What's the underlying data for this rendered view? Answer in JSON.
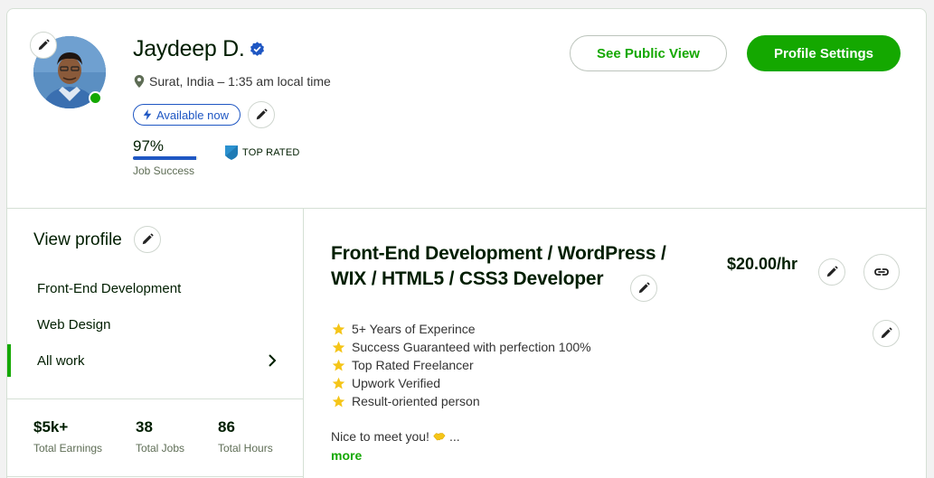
{
  "profile": {
    "name": "Jaydeep D.",
    "location": "Surat, India – 1:35 am local time",
    "availability": "Available now",
    "job_success_pct": "97%",
    "job_success_value": 97,
    "job_success_label": "Job Success",
    "badge": "TOP RATED"
  },
  "actions": {
    "public_view": "See Public View",
    "settings": "Profile Settings"
  },
  "sidebar": {
    "heading": "View profile",
    "items": [
      {
        "label": "Front-End Development"
      },
      {
        "label": "Web Design"
      },
      {
        "label": "All work"
      }
    ],
    "stats": [
      {
        "value": "$5k+",
        "label": "Total Earnings"
      },
      {
        "value": "38",
        "label": "Total Jobs"
      },
      {
        "value": "86",
        "label": "Total Hours"
      }
    ]
  },
  "main": {
    "title": "Front-End Development / WordPress / WIX / HTML5 / CSS3 Developer",
    "rate": "$20.00/hr",
    "features": [
      "5+ Years of Experince",
      "Success Guaranteed with perfection 100%",
      "Top Rated Freelancer",
      "Upwork Verified",
      "Result-oriented person"
    ],
    "intro_text": "Nice to meet you!",
    "ellipsis": "...",
    "more": "more"
  },
  "colors": {
    "brand_green": "#14a800",
    "accent_blue": "#1f57c3",
    "star_yellow": "#f5c518"
  },
  "icons": [
    "pencil-icon",
    "verified-icon",
    "location-icon",
    "lightning-icon",
    "top-rated-icon",
    "chevron-right-icon",
    "link-icon",
    "star-icon",
    "handshake-icon"
  ]
}
